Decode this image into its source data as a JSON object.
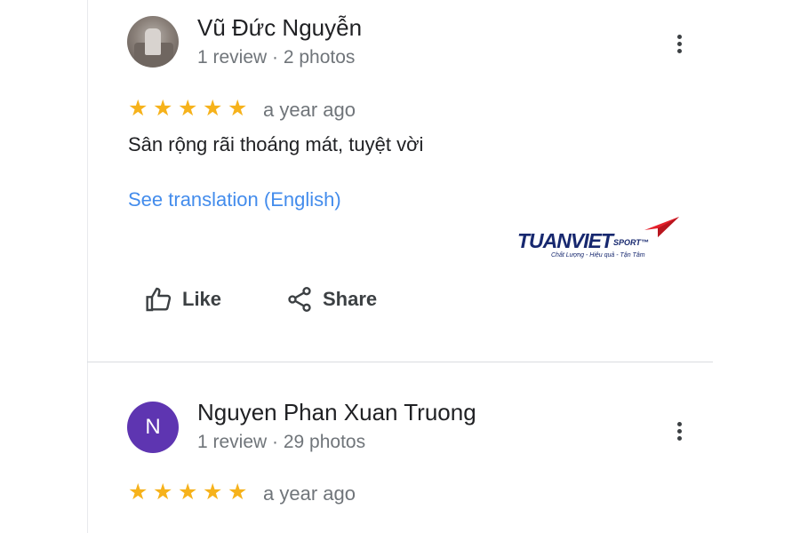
{
  "reviews": [
    {
      "author": "Vũ Đức Nguyễn",
      "meta": "1 review · 2 photos",
      "rating": 5,
      "rating_max": 5,
      "time": "a year ago",
      "text": "Sân rộng rãi thoáng mát, tuyệt vời",
      "translate_label": "See translation (English)",
      "like_label": "Like",
      "share_label": "Share"
    },
    {
      "author": "Nguyen Phan Xuan Truong",
      "avatar_letter": "N",
      "meta": "1 review · 29 photos",
      "rating": 5,
      "rating_max": 5,
      "time": "a year ago"
    }
  ],
  "watermark": {
    "brand": "TUANVIET",
    "sub": "SPORT™",
    "tagline": "Chất Lượng - Hiệu quả - Tận Tâm"
  },
  "colors": {
    "star": "#f6b21b",
    "avatar_letter_bg": "#5e35b1",
    "link": "#1a73e8",
    "brand_navy": "#17286f",
    "brand_red": "#e5202b"
  },
  "icons": {
    "more": "more-vert-icon",
    "like": "thumb-up-icon",
    "share": "share-icon",
    "star": "star-icon"
  }
}
